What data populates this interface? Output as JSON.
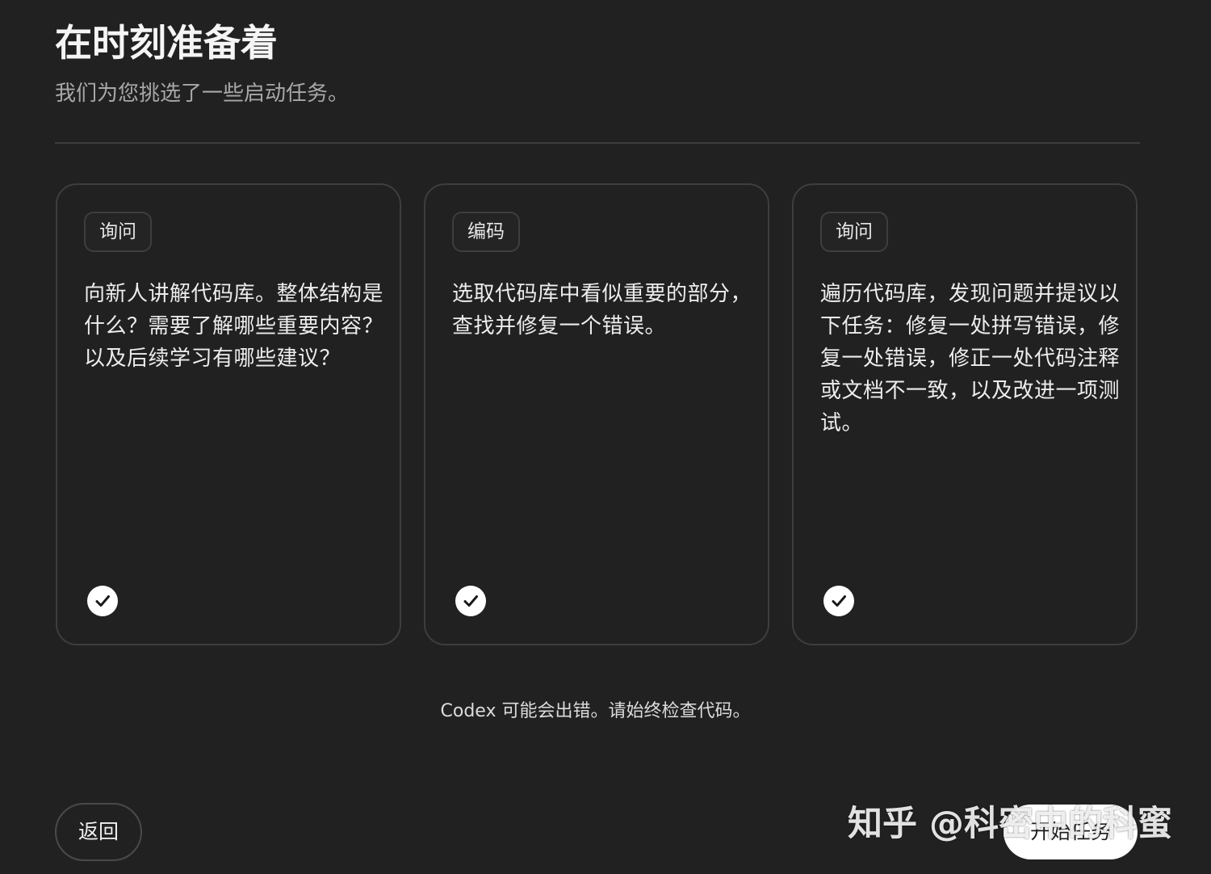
{
  "header": {
    "title": "在时刻准备着",
    "subtitle": "我们为您挑选了一些启动任务。"
  },
  "cards": [
    {
      "tag": "询问",
      "text": "向新人讲解代码库。整体结构是什么？需要了解哪些重要内容？以及后续学习有哪些建议？",
      "selected": true,
      "icon": "check-icon"
    },
    {
      "tag": "编码",
      "text": "选取代码库中看似重要的部分，查找并修复一个错误。",
      "selected": true,
      "icon": "check-icon"
    },
    {
      "tag": "询问",
      "text": "遍历代码库，发现问题并提议以下任务：修复一处拼写错误，修复一处错误，修正一处代码注释或文档不一致，以及改进一项测试。",
      "selected": true,
      "icon": "check-icon"
    }
  ],
  "footer": {
    "disclaimer": "Codex 可能会出错。请始终检查代码。",
    "back_label": "返回",
    "start_label": "开始任务"
  },
  "watermark": {
    "text": "知乎 @科密中的科蜜"
  },
  "colors": {
    "background": "#212121",
    "card_border": "#3e3e3e",
    "primary_button": "#ffffff",
    "text": "#ececec",
    "muted_text": "#a8a8a8"
  }
}
